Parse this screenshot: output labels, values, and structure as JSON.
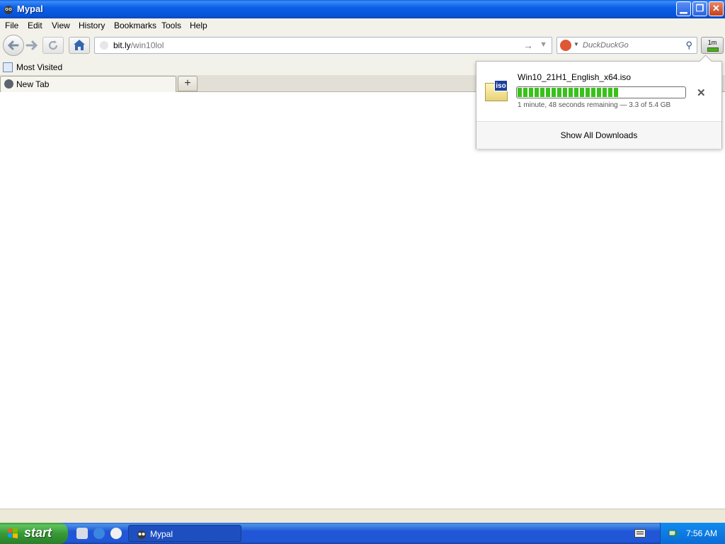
{
  "window": {
    "title": "Mypal"
  },
  "menu": [
    "File",
    "Edit",
    "View",
    "History",
    "Bookmarks",
    "Tools",
    "Help"
  ],
  "navbar": {
    "url_host": "bit.ly",
    "url_path": "/win10lol",
    "search_placeholder": "DuckDuckGo",
    "download_button_time": "1m"
  },
  "bookmarks": {
    "items": [
      {
        "label": "Most Visited"
      }
    ]
  },
  "tabs": [
    {
      "label": "New Tab"
    }
  ],
  "downloads": {
    "file_name": "Win10_21H1_English_x64.iso",
    "file_type_badge": "iso",
    "progress_fraction": 0.61,
    "status": "1 minute, 48 seconds remaining — 3.3 of 5.4 GB",
    "show_all_label": "Show All Downloads"
  },
  "taskbar": {
    "start_label": "start",
    "task_label": "Mypal",
    "clock": "7:56 AM"
  },
  "colors": {
    "titlebar": "#0553d6",
    "progress_green": "#38c21a",
    "start_green": "#379a37",
    "taskbar_blue": "#2157d7"
  },
  "icons": [
    "mypal-icon",
    "minimize-icon",
    "maximize-icon",
    "close-icon",
    "back-icon",
    "forward-icon",
    "reload-icon",
    "home-icon",
    "go-arrow-icon",
    "search-icon",
    "download-icon",
    "most-visited-icon",
    "globe-icon",
    "plus-icon",
    "iso-file-icon",
    "cancel-icon",
    "windows-flag-icon",
    "keyboard-icon",
    "network-icon"
  ]
}
